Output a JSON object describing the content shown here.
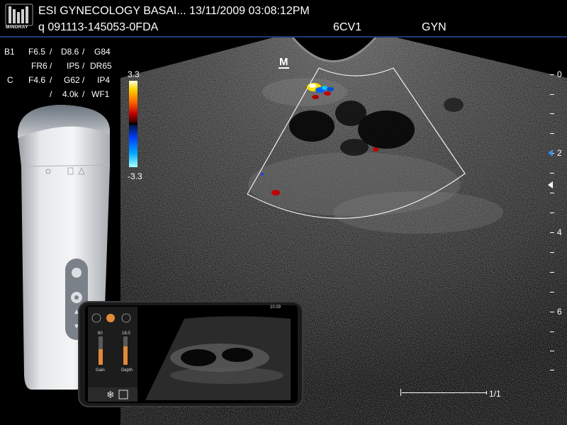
{
  "header": {
    "logo_text": "MINDRAY",
    "title": "ESI GYNECOLOGY BASAI... 13/11/2009    03:08:12PM",
    "patient_id": "q 091113-145053-0FDA",
    "probe": "6CV1",
    "exam_mode": "GYN"
  },
  "params": {
    "b_label": "B1",
    "c_label": "C",
    "rows": [
      [
        "F6.5",
        "/",
        "D8.6",
        "/",
        "G84"
      ],
      [
        "FR6",
        "/",
        "IP5",
        "/",
        "DR65"
      ],
      [
        "F4.6",
        "/",
        "G62",
        "/",
        "IP4"
      ],
      [
        "/",
        "4.0k",
        "/",
        "WF1"
      ]
    ]
  },
  "color_scale": {
    "top": "3.3",
    "bottom": "-3.3"
  },
  "depth_scale": {
    "labels": [
      "0",
      "2",
      "4",
      "6"
    ]
  },
  "orientation_mark": "M",
  "scale_bar": {
    "page": "1/1"
  },
  "phone": {
    "time": "10:29",
    "gain_value": "60",
    "depth_value": "18.0",
    "gain_label": "Gain",
    "depth_label": "Depth"
  },
  "colors": {
    "header_rule": "#1e3a78",
    "focus_marker": "#3a8fe0"
  }
}
